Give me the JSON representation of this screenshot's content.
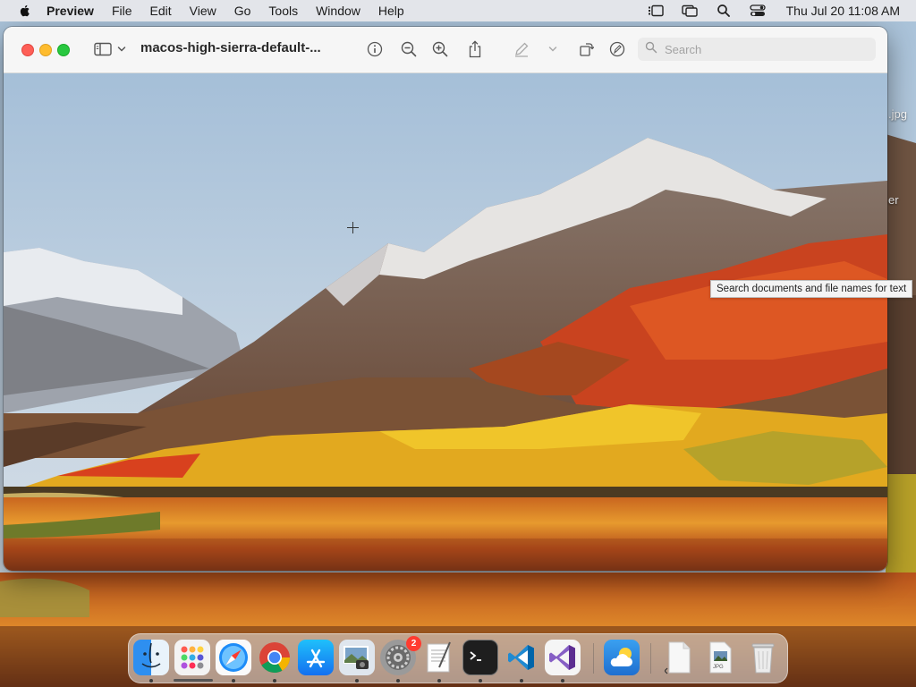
{
  "menubar": {
    "app_name": "Preview",
    "menus": [
      "File",
      "Edit",
      "View",
      "Go",
      "Tools",
      "Window",
      "Help"
    ],
    "clock": "Thu Jul 20  11:08 AM"
  },
  "window": {
    "title": "macos-high-sierra-default-...",
    "search_placeholder": "Search"
  },
  "tooltip": {
    "text": "Search documents and file names for text"
  },
  "desktop": {
    "file_label_1": ".jpg",
    "file_label_2": "er"
  },
  "dock": {
    "apps": [
      {
        "name": "Finder",
        "icon": "finder-icon"
      },
      {
        "name": "Launchpad",
        "icon": "launchpad-icon"
      },
      {
        "name": "Safari",
        "icon": "safari-icon"
      },
      {
        "name": "Chrome",
        "icon": "chrome-icon"
      },
      {
        "name": "App Store",
        "icon": "app-store-icon"
      },
      {
        "name": "Preview",
        "icon": "preview-icon"
      },
      {
        "name": "System Settings",
        "icon": "gear-icon",
        "badge": "2"
      },
      {
        "name": "TextEdit",
        "icon": "textedit-icon"
      },
      {
        "name": "Terminal",
        "icon": "terminal-icon"
      },
      {
        "name": "VS Code",
        "icon": "vscode-icon"
      },
      {
        "name": "Visual Studio",
        "icon": "visual-studio-icon"
      },
      {
        "name": "Weather",
        "icon": "weather-icon"
      },
      {
        "name": "Document",
        "icon": "document-icon"
      },
      {
        "name": "JPG File",
        "icon": "jpg-file-icon",
        "label": "JPG"
      },
      {
        "name": "Trash",
        "icon": "trash-icon"
      }
    ]
  },
  "colors": {
    "close": "#fe5f57",
    "minimize": "#febc2e",
    "maximize": "#28c840",
    "badge": "#ff3b30"
  }
}
